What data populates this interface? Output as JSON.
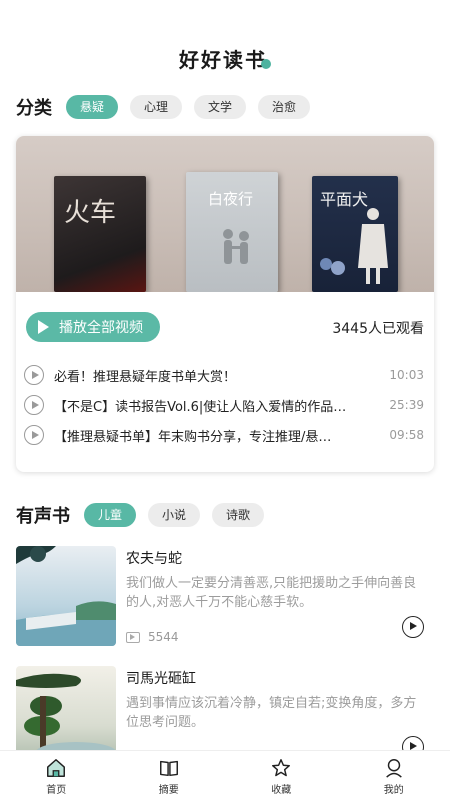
{
  "header": {
    "title": "好好读书"
  },
  "category": {
    "title": "分类",
    "chips": [
      {
        "label": "悬疑",
        "active": true
      },
      {
        "label": "心理",
        "active": false
      },
      {
        "label": "文学",
        "active": false
      },
      {
        "label": "治愈",
        "active": false
      }
    ]
  },
  "featured": {
    "books": [
      {
        "title": "火车"
      },
      {
        "title": "白夜行"
      },
      {
        "title": "平面犬"
      }
    ],
    "play_all_label": "播放全部视频",
    "watched_text": "3445人已观看",
    "videos": [
      {
        "title": "必看！推理悬疑年度书单大赏！",
        "duration": "10:03"
      },
      {
        "title": "【不是C】读书报告Vol.6|使让人陷入爱情的作品…",
        "duration": "25:39"
      },
      {
        "title": "【推理悬疑书单】年末购书分享，专注推理/悬…",
        "duration": "09:58"
      }
    ]
  },
  "audiobooks": {
    "title": "有声书",
    "chips": [
      {
        "label": "儿童",
        "active": true
      },
      {
        "label": "小说",
        "active": false
      },
      {
        "label": "诗歌",
        "active": false
      }
    ],
    "items": [
      {
        "title": "农夫与蛇",
        "desc": "我们做人一定要分清善恶,只能把援助之手伸向善良的人,对恶人千万不能心慈手软。",
        "count": "5544"
      },
      {
        "title": "司馬光砸缸",
        "desc": "遇到事情应该沉着冷静，镇定自若;变换角度，多方位思考问题。",
        "count": ""
      }
    ]
  },
  "tabbar": {
    "tabs": [
      {
        "label": "首页",
        "icon": "home-icon"
      },
      {
        "label": "摘要",
        "icon": "book-open-icon"
      },
      {
        "label": "收藏",
        "icon": "star-icon"
      },
      {
        "label": "我的",
        "icon": "profile-icon"
      }
    ]
  },
  "colors": {
    "accent": "#58b8a5"
  }
}
